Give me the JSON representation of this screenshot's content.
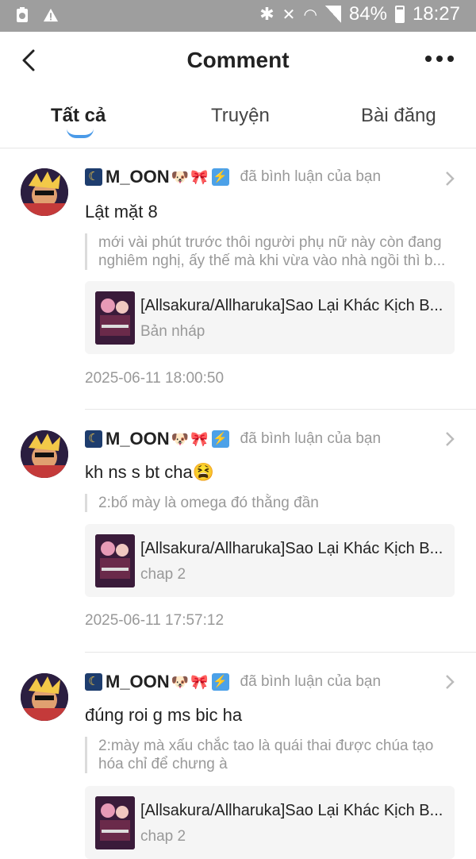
{
  "status_bar": {
    "battery": "84%",
    "time": "18:27"
  },
  "header": {
    "title": "Comment"
  },
  "tabs": [
    {
      "label": "Tất cả"
    },
    {
      "label": "Truyện"
    },
    {
      "label": "Bài đăng"
    }
  ],
  "comments": [
    {
      "username": "M_OON",
      "action": "đã bình luận của bạn",
      "text": "Lật mặt 8",
      "quote_lines": [
        "mới vài phút trước thôi người phụ nữ này còn đang",
        "nghiêm nghị, ấy thế mà khi vừa vào nhà ngồi thì b..."
      ],
      "story_title": "[Allsakura/Allharuka]Sao Lại Khác Kịch B...",
      "story_sub": "Bản nháp",
      "timestamp": "2025-06-11 18:00:50"
    },
    {
      "username": "M_OON",
      "action": "đã bình luận của bạn",
      "text": "kh ns s bt cha😫",
      "quote_lines": [
        "2:bố mày là omega đó thằng đần"
      ],
      "story_title": "[Allsakura/Allharuka]Sao Lại Khác Kịch B...",
      "story_sub": "chap 2",
      "timestamp": "2025-06-11 17:57:12"
    },
    {
      "username": "M_OON",
      "action": "đã bình luận của bạn",
      "text": "đúng roi g ms bic ha",
      "quote_lines": [
        "2:mày mà xấu chắc tao là quái thai được chúa tạo",
        "hóa chỉ để chưng à"
      ],
      "story_title": "[Allsakura/Allharuka]Sao Lại Khác Kịch B...",
      "story_sub": "chap 2",
      "timestamp": ""
    }
  ],
  "colors": {
    "accent": "#4a9ae8",
    "status_bar": "#9e9e9e",
    "muted_text": "#999999"
  },
  "icons": [
    "back-arrow-icon",
    "more-icon",
    "chevron-right-icon",
    "moon-icon",
    "dog-icon",
    "bow-icon",
    "lightning-icon"
  ]
}
